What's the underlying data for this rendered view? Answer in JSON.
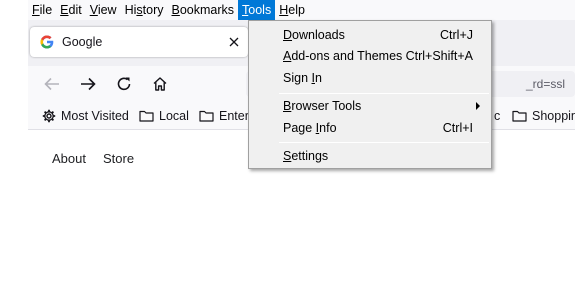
{
  "menubar": {
    "items": [
      {
        "label": "File",
        "mnemonic": "F",
        "rest": "ile"
      },
      {
        "label": "Edit",
        "mnemonic": "E",
        "rest": "dit"
      },
      {
        "label": "View",
        "mnemonic": "V",
        "rest": "iew"
      },
      {
        "label": "History",
        "mnemonic": "s",
        "pre": "Hi",
        "rest": "tory"
      },
      {
        "label": "Bookmarks",
        "mnemonic": "B",
        "rest": "ookmarks"
      },
      {
        "label": "Tools",
        "mnemonic": "T",
        "rest": "ools"
      },
      {
        "label": "Help",
        "mnemonic": "H",
        "rest": "elp"
      }
    ]
  },
  "tab": {
    "title": "Google",
    "favicon": "google-g-icon"
  },
  "urlbar": {
    "visible_text": "_rd=ssl"
  },
  "bookmarks": {
    "items": [
      {
        "label": "Most Visited",
        "icon": "gear-icon"
      },
      {
        "label": "Local",
        "icon": "folder-icon"
      },
      {
        "label": "Entert",
        "icon": "folder-icon"
      },
      {
        "label": "c",
        "icon": "none"
      },
      {
        "label": "Shoppin",
        "icon": "folder-icon"
      }
    ]
  },
  "page": {
    "links": [
      "About",
      "Store"
    ]
  },
  "tools_menu": {
    "items": [
      {
        "mnemonic": "D",
        "rest": "ownloads",
        "shortcut": "Ctrl+J"
      },
      {
        "mnemonic": "A",
        "rest": "dd-ons and Themes",
        "shortcut": "Ctrl+Shift+A"
      },
      {
        "pre": "Sign ",
        "mnemonic": "I",
        "rest": "n",
        "shortcut": ""
      },
      {
        "mnemonic": "B",
        "rest": "rowser Tools",
        "shortcut": "",
        "submenu": true
      },
      {
        "pre": "Page ",
        "mnemonic": "I",
        "rest": "nfo",
        "shortcut": "Ctrl+I"
      },
      {
        "mnemonic": "S",
        "rest": "ettings",
        "shortcut": ""
      }
    ]
  },
  "colors": {
    "menu_highlight": "#0078d7",
    "menu_bg": "#f0f0f0"
  }
}
